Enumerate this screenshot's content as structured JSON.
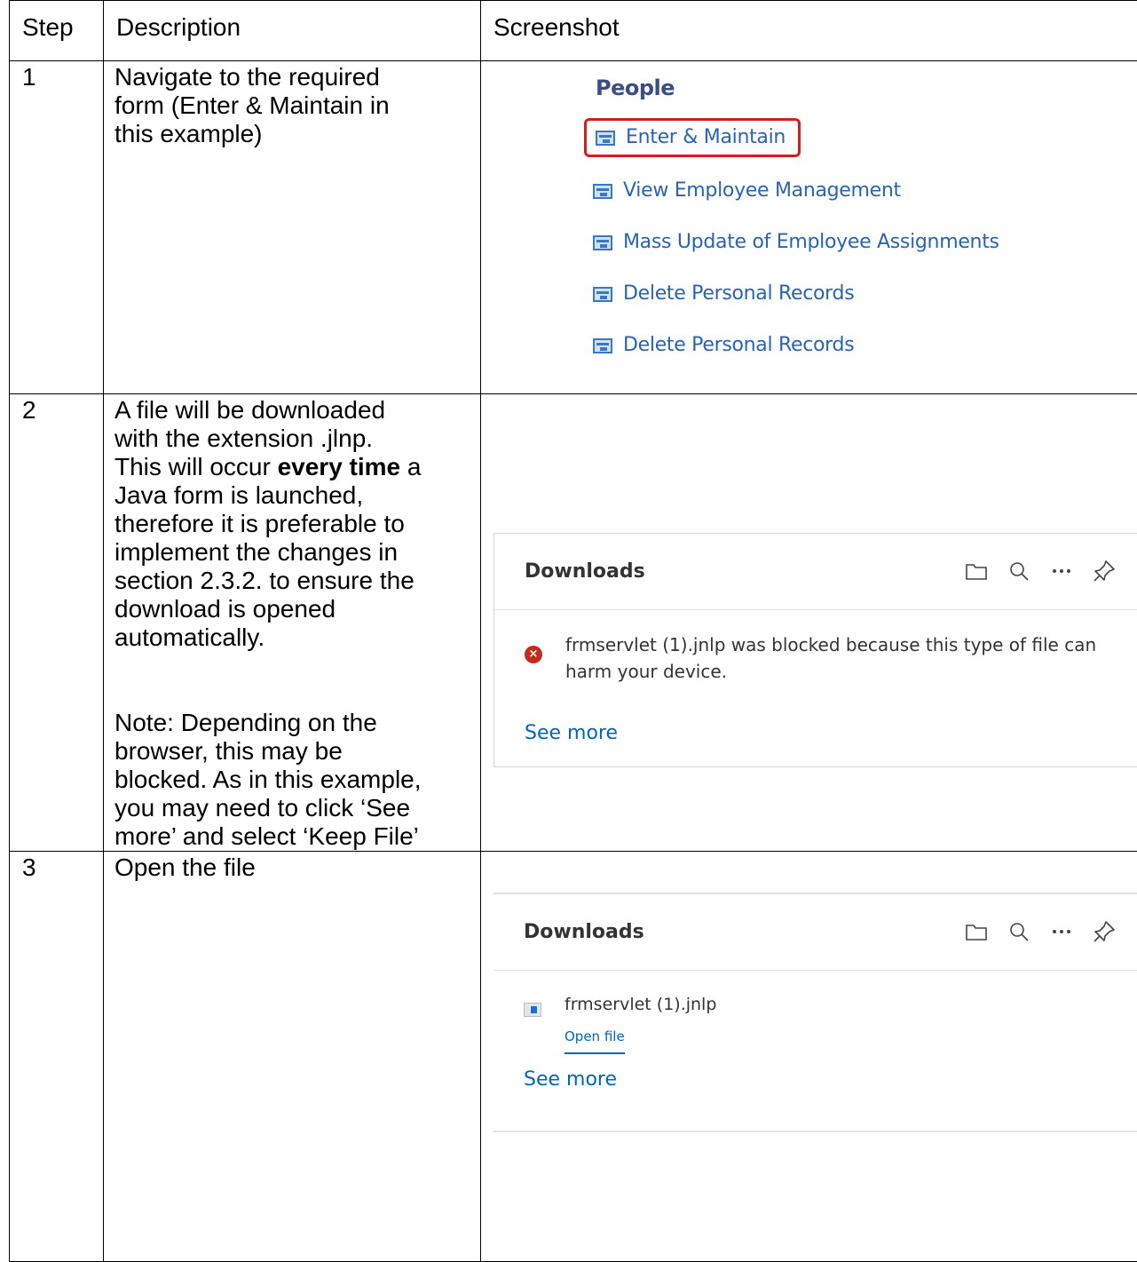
{
  "table": {
    "headers": [
      "Step",
      "Description",
      "Screenshot"
    ]
  },
  "rows": [
    {
      "step": "1",
      "description_lines": [
        "Navigate to the required",
        "form (Enter & Maintain in",
        "this example)"
      ]
    },
    {
      "step": "2",
      "description_lines": [
        "A file will be downloaded",
        "with the extension .jlnp.",
        "",
        "Java form is launched,",
        "therefore it is preferable to",
        "implement the changes in",
        "section 2.3.2. to ensure the",
        "download is opened",
        "automatically."
      ],
      "line3_prefix": "This will occur ",
      "line3_bold": "every time",
      "line3_suffix": " a",
      "note_lines": [
        "Note: Depending on the",
        "browser, this may be",
        "blocked. As in this example,",
        "you may need to click ‘See",
        "more’ and select ‘Keep File’"
      ]
    },
    {
      "step": "3",
      "description_lines": [
        "Open the file"
      ]
    }
  ],
  "people_menu": {
    "title": "People",
    "items": [
      "Enter & Maintain",
      "View Employee Management",
      "Mass Update of Employee Assignments",
      "Delete Personal Records",
      "Delete Personal Records"
    ],
    "icon": "form-icon",
    "highlight_color": "#d61d1d",
    "link_color": "#2864b4"
  },
  "downloads_blocked": {
    "title": "Downloads",
    "tools": [
      "folder-icon",
      "search-icon",
      "more-icon",
      "pin-icon"
    ],
    "message": "frmservlet (1).jnlp was blocked because this type of file can harm your device.",
    "message_line1": "frmservlet (1).jnlp was blocked because this type of file can",
    "message_line2": "harm your device.",
    "error_icon": "×",
    "see_more": "See more"
  },
  "downloads_open": {
    "title": "Downloads",
    "tools": [
      "folder-icon",
      "search-icon",
      "more-icon",
      "pin-icon"
    ],
    "file_name": "frmservlet (1).jnlp",
    "open_file": "Open file",
    "see_more": "See more"
  }
}
